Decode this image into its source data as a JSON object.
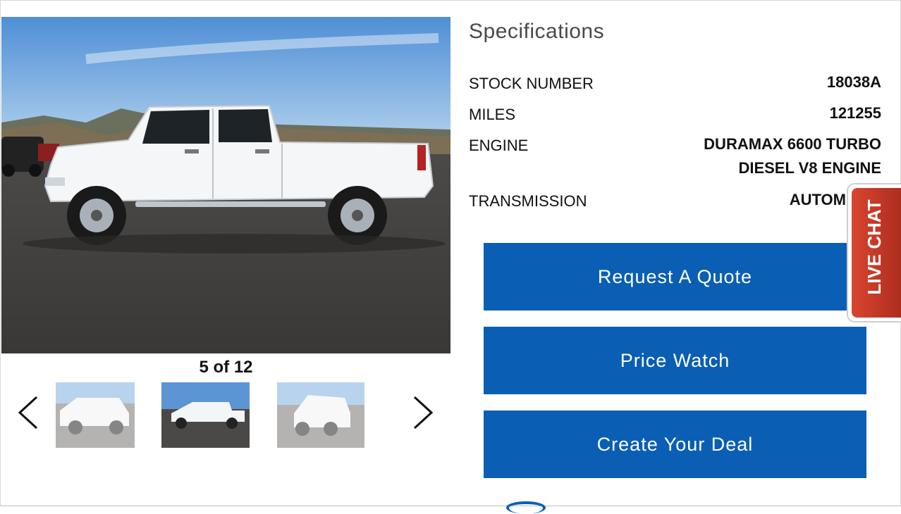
{
  "gallery": {
    "counter": "5 of 12",
    "prev_icon": "chevron-left-icon",
    "next_icon": "chevron-right-icon"
  },
  "specifications": {
    "title": "Specifications",
    "rows": [
      {
        "label": "STOCK NUMBER",
        "value": "18038A"
      },
      {
        "label": "MILES",
        "value": "121255"
      },
      {
        "label": "ENGINE",
        "value": "DURAMAX 6600 TURBO DIESEL V8 ENGINE"
      },
      {
        "label": "TRANSMISSION",
        "value": "AUTOM"
      }
    ]
  },
  "actions": {
    "request_quote": "Request A Quote",
    "price_watch": "Price Watch",
    "create_deal": "Create Your Deal"
  },
  "live_chat": {
    "label": "LIVE CHAT"
  },
  "colors": {
    "brand_blue": "#0a5fb4",
    "live_chat_red": "#c0392b"
  }
}
